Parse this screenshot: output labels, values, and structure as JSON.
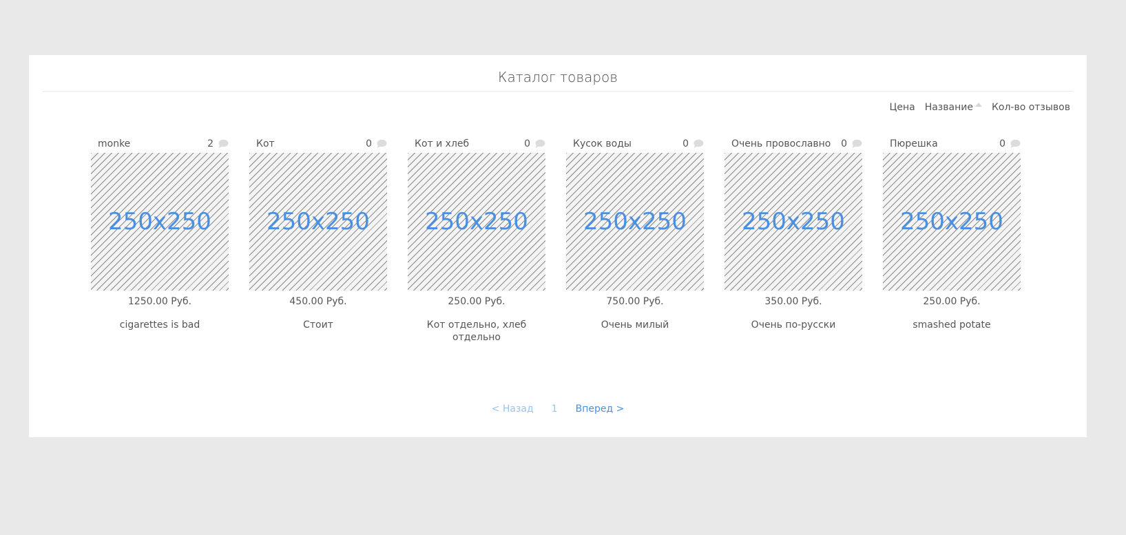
{
  "page": {
    "title": "Каталог товаров"
  },
  "sort": {
    "price_label": "Цена",
    "name_label": "Название",
    "reviews_label": "Кол-во отзывов",
    "active": "name"
  },
  "products": [
    {
      "name": "monke",
      "reviews": "2",
      "image_label": "250x250",
      "price": "1250.00 Руб.",
      "description": "cigarettes is bad"
    },
    {
      "name": "Кот",
      "reviews": "0",
      "image_label": "250x250",
      "price": "450.00 Руб.",
      "description": "Стоит"
    },
    {
      "name": "Кот и хлеб",
      "reviews": "0",
      "image_label": "250x250",
      "price": "250.00 Руб.",
      "description": "Кот отдельно, хлеб отдельно"
    },
    {
      "name": "Кусок воды",
      "reviews": "0",
      "image_label": "250x250",
      "price": "750.00 Руб.",
      "description": "Очень милый"
    },
    {
      "name": "Очень провославно",
      "reviews": "0",
      "image_label": "250x250",
      "price": "350.00 Руб.",
      "description": "Очень по-русски"
    },
    {
      "name": "Пюрешка",
      "reviews": "0",
      "image_label": "250x250",
      "price": "250.00 Руб.",
      "description": "smashed potate"
    }
  ],
  "pagination": {
    "prev_label": "< Назад",
    "current_page": "1",
    "next_label": "Вперед >"
  },
  "icons": {
    "comment": "comment-icon",
    "sort_arrow": "sort-arrow-up-icon"
  },
  "colors": {
    "background": "#e9e9e9",
    "panel": "#ffffff",
    "link_blue": "#4a90e2",
    "link_disabled": "#9cc3ea"
  }
}
